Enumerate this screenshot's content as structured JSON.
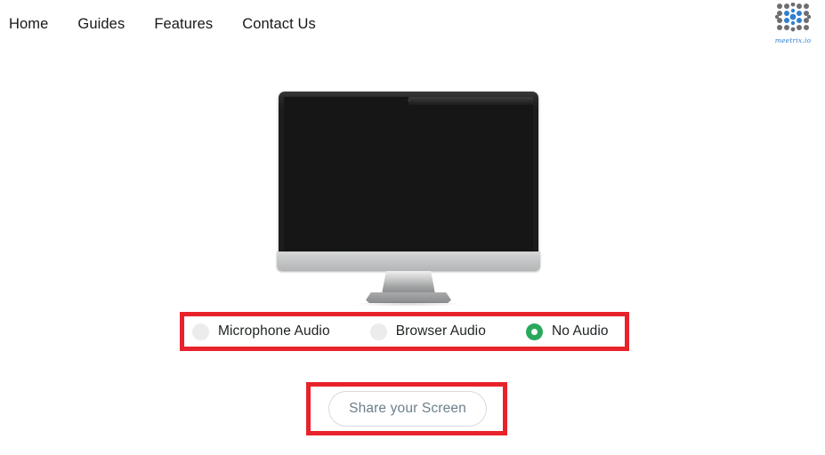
{
  "header": {
    "nav": [
      {
        "label": "Home",
        "name": "nav-item-home"
      },
      {
        "label": "Guides",
        "name": "nav-item-guides"
      },
      {
        "label": "Features",
        "name": "nav-item-features"
      },
      {
        "label": "Contact Us",
        "name": "nav-item-contact-us"
      }
    ],
    "logo": {
      "wordmark": "meetrix.io",
      "icon": "meetrix-dot-matrix-logo",
      "dot_color_dark": "#6d6e71",
      "dot_color_accent": "#2f7fd1"
    }
  },
  "main": {
    "illustration": {
      "name": "desktop-monitor-illustration",
      "screen_color": "#161616",
      "bezel_color": "#1c1c1c",
      "chin_color": "#c9cacb"
    },
    "audio_options": {
      "selected": "No Audio",
      "items": [
        {
          "label": "Microphone Audio",
          "checked": false,
          "name": "radio-microphone-audio"
        },
        {
          "label": "Browser Audio",
          "checked": false,
          "name": "radio-browser-audio"
        },
        {
          "label": "No Audio",
          "checked": true,
          "name": "radio-no-audio"
        }
      ],
      "unchecked_color": "#ececec",
      "checked_color": "#2aa85c"
    },
    "share_button": {
      "label": "Share your Screen",
      "text_color": "#6b7f8c",
      "border_color": "#d8dadc"
    }
  },
  "annotations": {
    "color": "#e8222a",
    "boxes": [
      {
        "name": "highlight-audio-options",
        "target": "audio option row"
      },
      {
        "name": "highlight-share-button",
        "target": "Share your Screen button"
      }
    ]
  }
}
